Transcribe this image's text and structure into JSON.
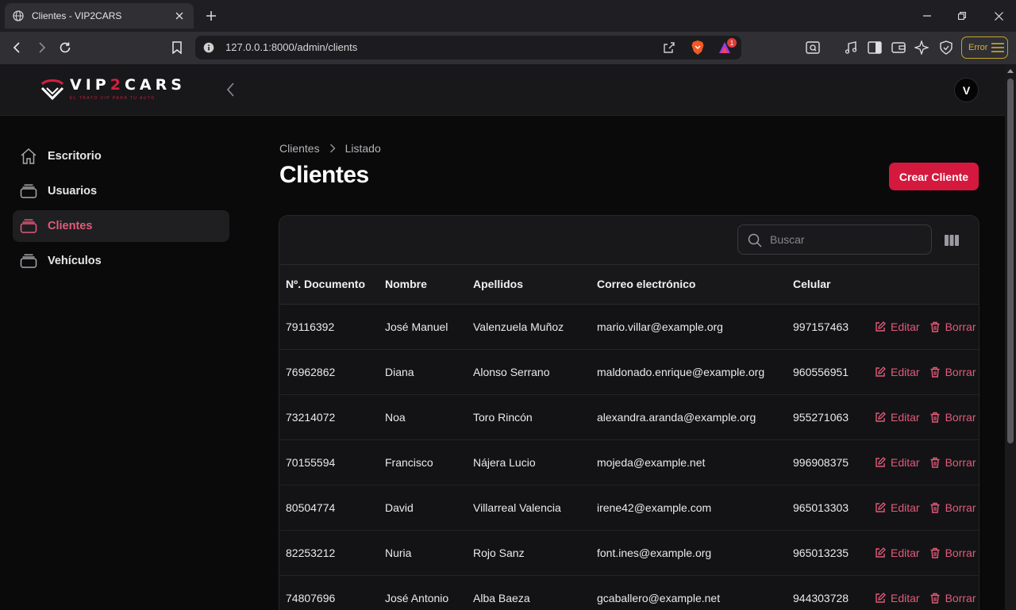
{
  "browser": {
    "tab_title": "Clientes - VIP2CARS",
    "url": "127.0.0.1:8000/admin/clients",
    "error_label": "Error",
    "notif_count": "1"
  },
  "header": {
    "brand": "VIP2CARS",
    "brand_left": "VIP",
    "brand_two": "2",
    "brand_right": "CARS",
    "tagline": "EL TRATO VIP PARA TU AUTO",
    "avatar_initial": "V"
  },
  "sidebar": {
    "items": [
      {
        "label": "Escritorio",
        "icon": "home-icon",
        "active": false
      },
      {
        "label": "Usuarios",
        "icon": "stack-icon",
        "active": false
      },
      {
        "label": "Clientes",
        "icon": "stack-icon",
        "active": true
      },
      {
        "label": "Vehículos",
        "icon": "stack-icon",
        "active": false
      }
    ]
  },
  "main": {
    "breadcrumb": [
      "Clientes",
      "Listado"
    ],
    "title": "Clientes",
    "create_button": "Crear Cliente",
    "search_placeholder": "Buscar"
  },
  "table": {
    "columns": [
      "Nº. Documento",
      "Nombre",
      "Apellidos",
      "Correo electrónico",
      "Celular"
    ],
    "edit_label": "Editar",
    "delete_label": "Borrar",
    "rows": [
      {
        "doc": "79116392",
        "nombre": "José Manuel",
        "apellidos": "Valenzuela Muñoz",
        "correo": "mario.villar@example.org",
        "celular": "997157463"
      },
      {
        "doc": "76962862",
        "nombre": "Diana",
        "apellidos": "Alonso Serrano",
        "correo": "maldonado.enrique@example.org",
        "celular": "960556951"
      },
      {
        "doc": "73214072",
        "nombre": "Noa",
        "apellidos": "Toro Rincón",
        "correo": "alexandra.aranda@example.org",
        "celular": "955271063"
      },
      {
        "doc": "70155594",
        "nombre": "Francisco",
        "apellidos": "Nájera Lucio",
        "correo": "mojeda@example.net",
        "celular": "996908375"
      },
      {
        "doc": "80504774",
        "nombre": "David",
        "apellidos": "Villarreal Valencia",
        "correo": "irene42@example.com",
        "celular": "965013303"
      },
      {
        "doc": "82253212",
        "nombre": "Nuria",
        "apellidos": "Rojo Sanz",
        "correo": "font.ines@example.org",
        "celular": "965013235"
      },
      {
        "doc": "74807696",
        "nombre": "José Antonio",
        "apellidos": "Alba Baeza",
        "correo": "gcaballero@example.net",
        "celular": "944303728"
      }
    ]
  },
  "colors": {
    "accent": "#d4183e",
    "accent_text": "#e25b78",
    "background": "#0a0a0b",
    "surface": "#18181b"
  }
}
